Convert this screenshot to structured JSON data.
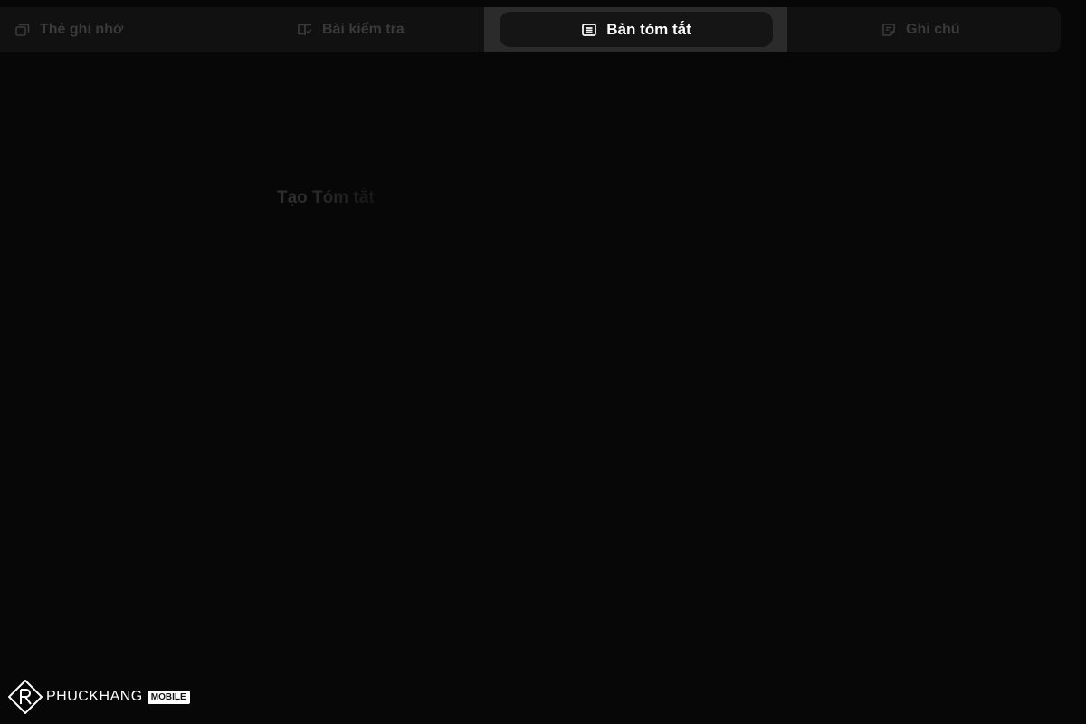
{
  "tabs": {
    "flashcards": {
      "label": "Thẻ ghi nhớ",
      "icon": "cards-icon",
      "active": false
    },
    "quiz": {
      "label": "Bài kiểm tra",
      "icon": "book-check-icon",
      "active": false
    },
    "summary": {
      "label": "Bản tóm tắt",
      "icon": "summary-list-icon",
      "active": true
    },
    "notes": {
      "label": "Ghi chú",
      "icon": "note-icon",
      "active": false
    }
  },
  "main": {
    "generate_label": "Tạo Tóm tắt"
  },
  "watermark": {
    "brand": "PHUCKHANG",
    "badge": "MOBILE"
  },
  "colors": {
    "background": "#070707",
    "tabbar": "#111111",
    "active_tab": "#2b2b2b",
    "active_pill": "#151515",
    "inactive_text": "#3a3a3a",
    "active_text": "#ffffff"
  }
}
